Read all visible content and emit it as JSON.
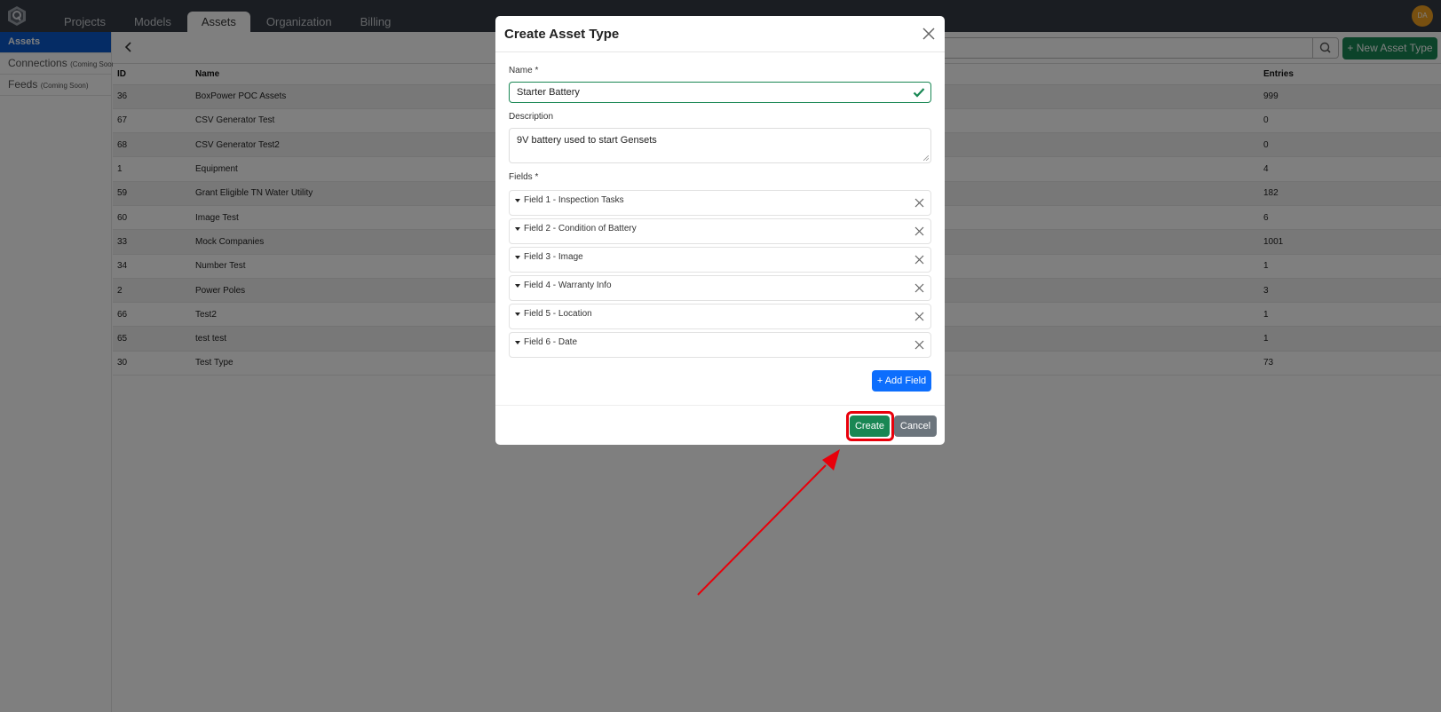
{
  "topnav": {
    "logo": "app-logo",
    "tabs": [
      {
        "label": "Projects",
        "active": false
      },
      {
        "label": "Models",
        "active": false
      },
      {
        "label": "Assets",
        "active": true
      },
      {
        "label": "Organization",
        "active": false
      },
      {
        "label": "Billing",
        "active": false
      }
    ],
    "avatar_initials": "DA",
    "avatar_color": "#f0a020"
  },
  "sidebar": {
    "items": [
      {
        "label": "Assets",
        "note": "",
        "active": true
      },
      {
        "label": "Connections",
        "note": "(Coming Soon)",
        "active": false
      },
      {
        "label": "Feeds",
        "note": "(Coming Soon)",
        "active": false
      }
    ]
  },
  "toolbar": {
    "back_icon": "chevron-left-icon",
    "search_placeholder": "",
    "search_icon": "search-icon",
    "new_button_label": "New Asset Type",
    "new_button_icon": "plus-icon"
  },
  "table": {
    "columns": [
      "ID",
      "Name",
      "Entries"
    ],
    "rows": [
      {
        "id": "36",
        "name": "BoxPower POC Assets",
        "entries": "999"
      },
      {
        "id": "67",
        "name": "CSV Generator Test",
        "entries": "0"
      },
      {
        "id": "68",
        "name": "CSV Generator Test2",
        "entries": "0"
      },
      {
        "id": "1",
        "name": "Equipment",
        "entries": "4"
      },
      {
        "id": "59",
        "name": "Grant Eligible TN Water Utility",
        "entries": "182"
      },
      {
        "id": "60",
        "name": "Image Test",
        "entries": "6"
      },
      {
        "id": "33",
        "name": "Mock Companies",
        "entries": "1001"
      },
      {
        "id": "34",
        "name": "Number Test",
        "entries": "1"
      },
      {
        "id": "2",
        "name": "Power Poles",
        "entries": "3"
      },
      {
        "id": "66",
        "name": "Test2",
        "entries": "1"
      },
      {
        "id": "65",
        "name": "test test",
        "entries": "1"
      },
      {
        "id": "30",
        "name": "Test Type",
        "entries": "73"
      }
    ]
  },
  "modal": {
    "title": "Create Asset Type",
    "close_icon": "close-icon",
    "name_label": "Name *",
    "name_value": "Starter Battery",
    "name_valid": true,
    "description_label": "Description",
    "description_value": "9V battery used to start Gensets",
    "fields_label": "Fields *",
    "fields": [
      {
        "label": "Field 1 - Inspection Tasks"
      },
      {
        "label": "Field 2 - Condition of Battery"
      },
      {
        "label": "Field 3 - Image"
      },
      {
        "label": "Field 4 - Warranty Info"
      },
      {
        "label": "Field 5 - Location"
      },
      {
        "label": "Field 6 - Date"
      }
    ],
    "add_field_label": "+ Add Field",
    "create_label": "Create",
    "cancel_label": "Cancel"
  },
  "colors": {
    "nav_bg": "#343a45",
    "primary": "#0d6efd",
    "success": "#198754",
    "secondary": "#6c757d",
    "sidebar_active": "#0a58ca",
    "annotation": "#e8000b"
  },
  "annotation": {
    "type": "arrow-with-highlight",
    "target": "create-button"
  }
}
